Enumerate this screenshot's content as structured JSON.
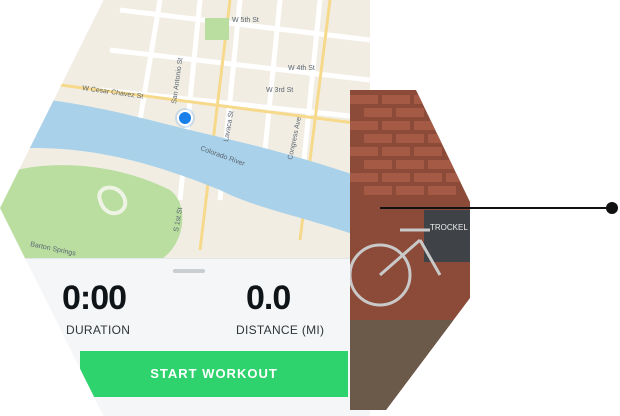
{
  "map": {
    "streets": [
      "W 5th St",
      "W 4th St",
      "W 3rd St",
      "W Cesar Chavez St",
      "San Antonio St",
      "Lavaca St",
      "Congress Ave",
      "Colorado River",
      "S 1st St",
      "Barton Springs"
    ],
    "location_color": "#1a7fe8"
  },
  "workout": {
    "duration_value": "0:00",
    "duration_label": "DURATION",
    "distance_value": "0.0",
    "distance_label": "DISTANCE (MI)",
    "start_label": "START WORKOUT",
    "accent_color": "#2fd36d"
  },
  "photo": {
    "sign_text": "TROCKEL CAFE"
  }
}
